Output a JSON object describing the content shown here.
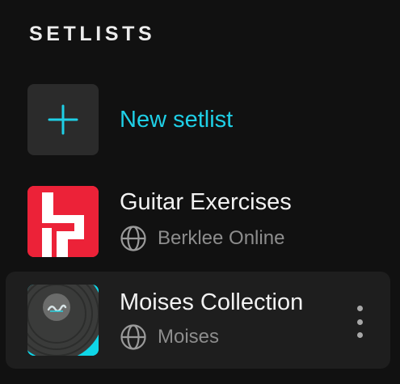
{
  "setlists": {
    "title": "SETLISTS",
    "new_setlist": {
      "label": "New setlist",
      "icon": "plus-icon"
    },
    "items": [
      {
        "title": "Guitar Exercises",
        "owner": "Berklee Online",
        "thumb_icon": "berklee-logo-icon",
        "owner_icon": "globe-icon"
      },
      {
        "title": "Moises Collection",
        "owner": "Moises",
        "thumb_icon": "vinyl-record-icon",
        "owner_icon": "globe-icon",
        "menu_icon": "more-vertical-icon"
      }
    ]
  },
  "colors": {
    "background": "#111111",
    "accent": "#1fcfe6",
    "berklee_red": "#ec2238",
    "selected_row": "#1e1e1e",
    "muted_text": "#8d8d8d"
  }
}
